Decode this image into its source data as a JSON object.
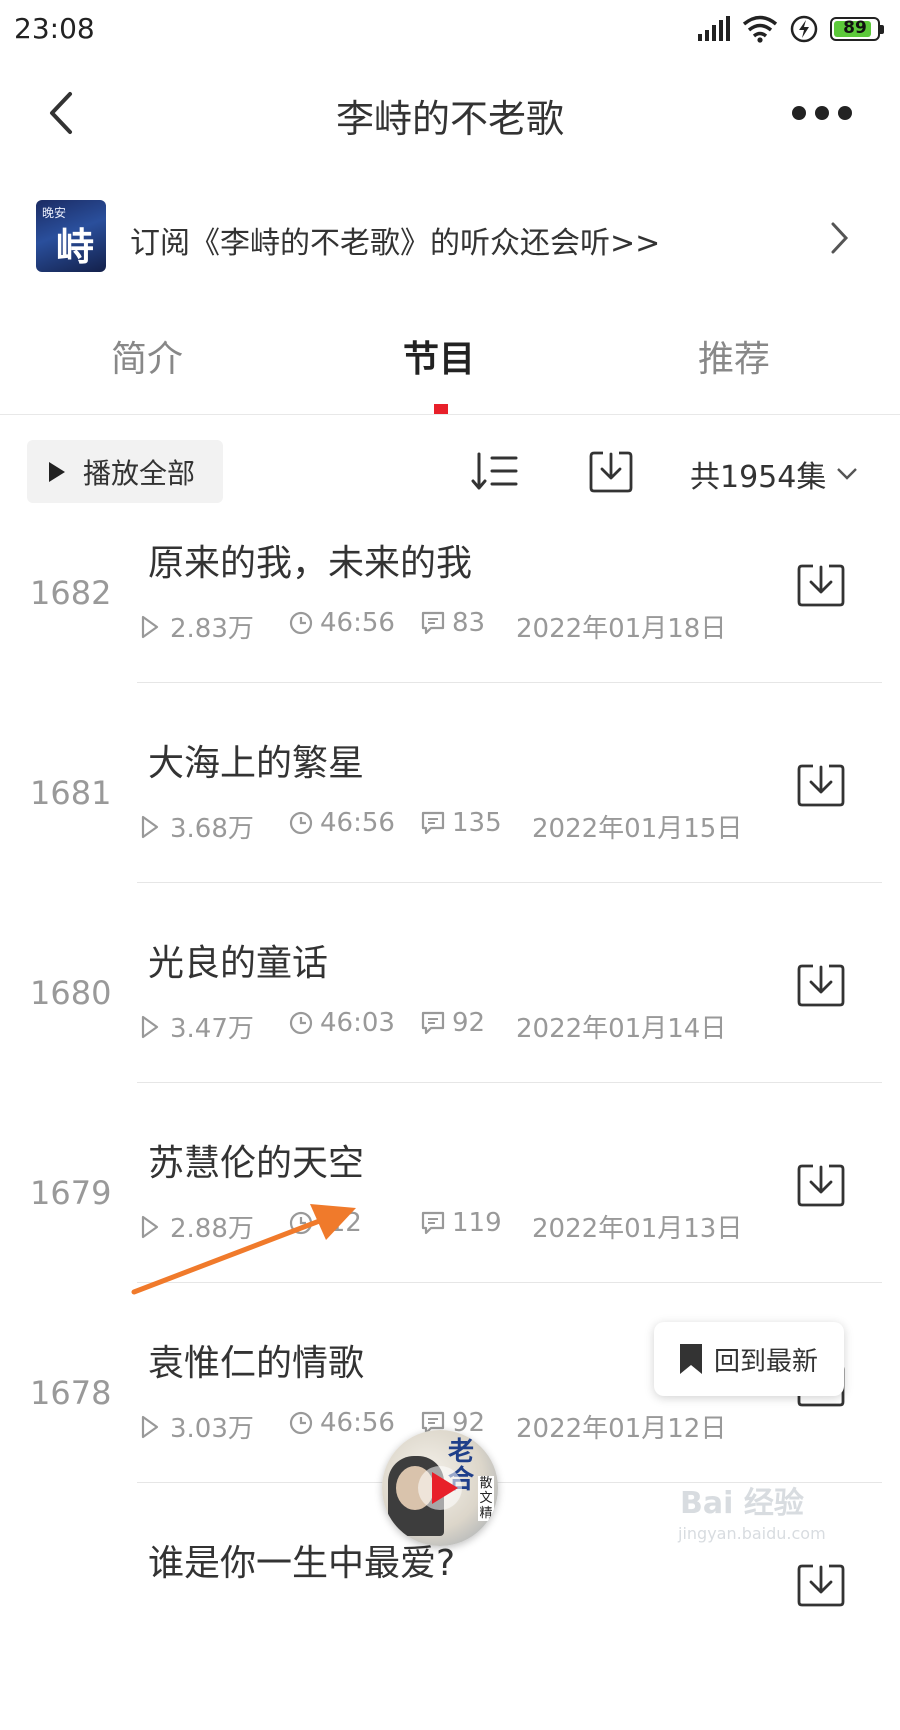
{
  "status_bar": {
    "time": "23:08",
    "battery": "89",
    "icons": [
      "signal-icon",
      "wifi-icon",
      "charging-icon",
      "battery-icon"
    ]
  },
  "header": {
    "title": "李峙的不老歌",
    "back_icon": "chevron-left-icon",
    "more_icon": "more-dots-icon"
  },
  "banner": {
    "cover_small_text": "晚安",
    "cover_big_text": "峙",
    "text": "订阅《李峙的不老歌》的听众还会听>>"
  },
  "tabs": [
    {
      "label": "简介",
      "active": false
    },
    {
      "label": "节目",
      "active": true
    },
    {
      "label": "推荐",
      "active": false
    }
  ],
  "toolbar": {
    "play_all_label": "播放全部",
    "episode_count": "共1954集"
  },
  "episodes": [
    {
      "num": "1682",
      "title": "原来的我，未来的我",
      "plays": "2.83万",
      "duration": "46:56",
      "comments": "83",
      "date": "2022年01月18日"
    },
    {
      "num": "1681",
      "title": "大海上的繁星",
      "plays": "3.68万",
      "duration": "46:56",
      "comments": "135",
      "date": "2022年01月15日"
    },
    {
      "num": "1680",
      "title": "光良的童话",
      "plays": "3.47万",
      "duration": "46:03",
      "comments": "92",
      "date": "2022年01月14日"
    },
    {
      "num": "1679",
      "title": "苏慧伦的天空",
      "plays": "2.88万",
      "duration": ":12",
      "comments": "119",
      "date": "2022年01月13日"
    },
    {
      "num": "1678",
      "title": "袁惟仁的情歌",
      "plays": "3.03万",
      "duration": "46:56",
      "comments": "92",
      "date": "2022年01月12日"
    },
    {
      "num": "",
      "title": "谁是你一生中最爱?",
      "plays": "",
      "duration": "",
      "comments": "",
      "date": ""
    }
  ],
  "back_to_latest": {
    "label": "回到最新"
  },
  "player": {
    "tag": "老合",
    "tag_small": "散文精"
  },
  "watermark": {
    "main": "Bai 经验",
    "sub": "jingyan.baidu.com"
  },
  "colors": {
    "accent": "#e8202a",
    "annotation_arrow": "#f07a2b",
    "battery": "#5cc93a"
  }
}
